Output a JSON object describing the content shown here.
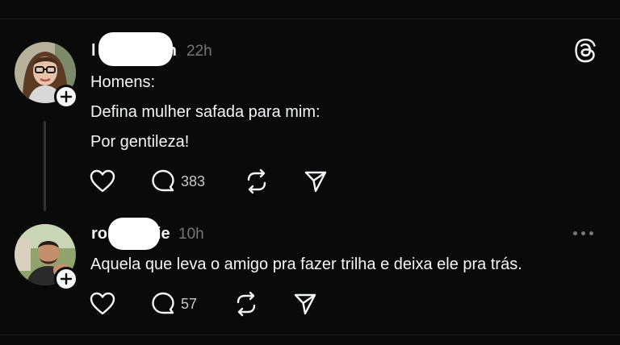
{
  "posts": [
    {
      "username_start": "l",
      "username_end": "h",
      "time": "22h",
      "lines": [
        "Homens:",
        "Defina mulher safada para mim:",
        "Por gentileza!"
      ],
      "replies": "383"
    },
    {
      "username_start": "ro",
      "username_end": "ie",
      "time": "10h",
      "lines": [
        "Aquela que leva o amigo pra fazer trilha e deixa ele pra trás."
      ],
      "replies": "57"
    }
  ],
  "icons": {
    "logo": "threads-logo-icon",
    "like": "heart-icon",
    "reply": "comment-icon",
    "repost": "repost-icon",
    "share": "send-icon",
    "follow": "plus-icon",
    "more": "more-dots-icon"
  },
  "colors": {
    "background": "#0a0a0a",
    "text": "#f3f5f7",
    "muted": "#777777",
    "redaction": "#ffffff"
  }
}
